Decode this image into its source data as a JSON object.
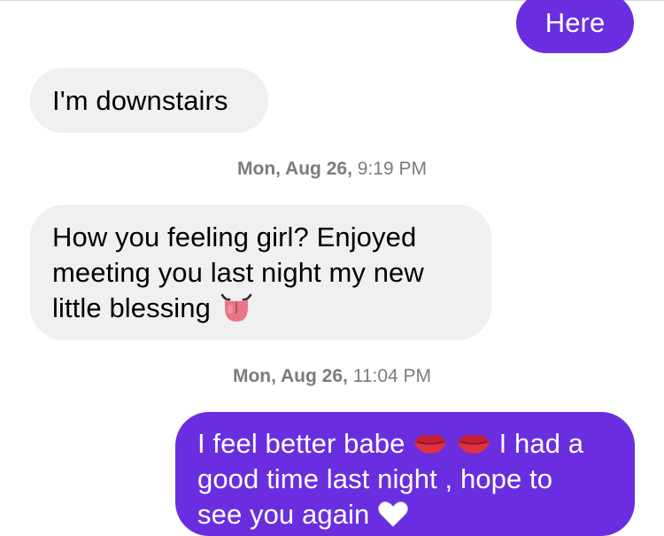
{
  "conversation": {
    "messages": [
      {
        "type": "sent",
        "text": "Here"
      },
      {
        "type": "received",
        "text": "I'm downstairs"
      },
      {
        "type": "timestamp",
        "day": "Mon, Aug 26,",
        "time": "9:19 PM"
      },
      {
        "type": "received",
        "lines": [
          "How you feeling girl? Enjoyed",
          "meeting you last night my new",
          "little blessing"
        ],
        "emoji": "tongue-emoji"
      },
      {
        "type": "timestamp",
        "day": "Mon, Aug 26,",
        "time": "11:04 PM"
      },
      {
        "type": "sent",
        "parts": [
          "I feel better babe",
          "I had a"
        ],
        "line2": "good time last night , hope to",
        "line3_partial": "see you again",
        "emojis": [
          "kiss-mark-emoji",
          "kiss-mark-emoji",
          "white-heart-emoji"
        ]
      }
    ]
  },
  "colors": {
    "sent_bubble": "#6a2ee0",
    "received_bubble": "#f0f0f0",
    "timestamp_text": "#7b7b80"
  }
}
